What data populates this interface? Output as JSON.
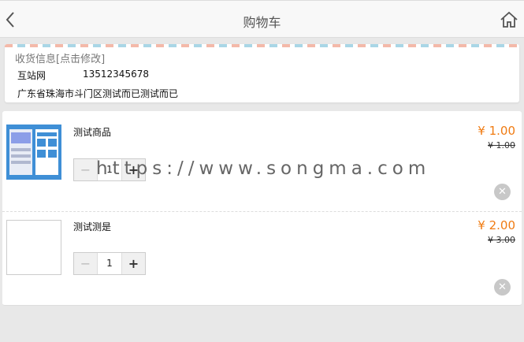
{
  "header": {
    "title": "购物车"
  },
  "address": {
    "heading": "收货信息[点击修改]",
    "name": "互站网",
    "phone": "13512345678",
    "full_address": "广东省珠海市斗门区测试而已测试而已"
  },
  "cart": {
    "items": [
      {
        "name": "测试商品",
        "price": "¥ 1.00",
        "original_price": "¥ 1.00",
        "quantity": "1"
      },
      {
        "name": "测试测是",
        "price": "¥ 2.00",
        "original_price": "¥ 3.00",
        "quantity": "1"
      }
    ],
    "decrement_label": "−",
    "increment_label": "+",
    "remove_label": "✕"
  },
  "watermark": "https://www.songma.com",
  "colors": {
    "accent_price": "#f07b12",
    "header_bg": "#f8f8f8",
    "page_bg": "#e8e8e8"
  },
  "icons": {
    "back": "chevron-left-icon",
    "home": "home-icon",
    "remove": "close-circle-icon"
  }
}
